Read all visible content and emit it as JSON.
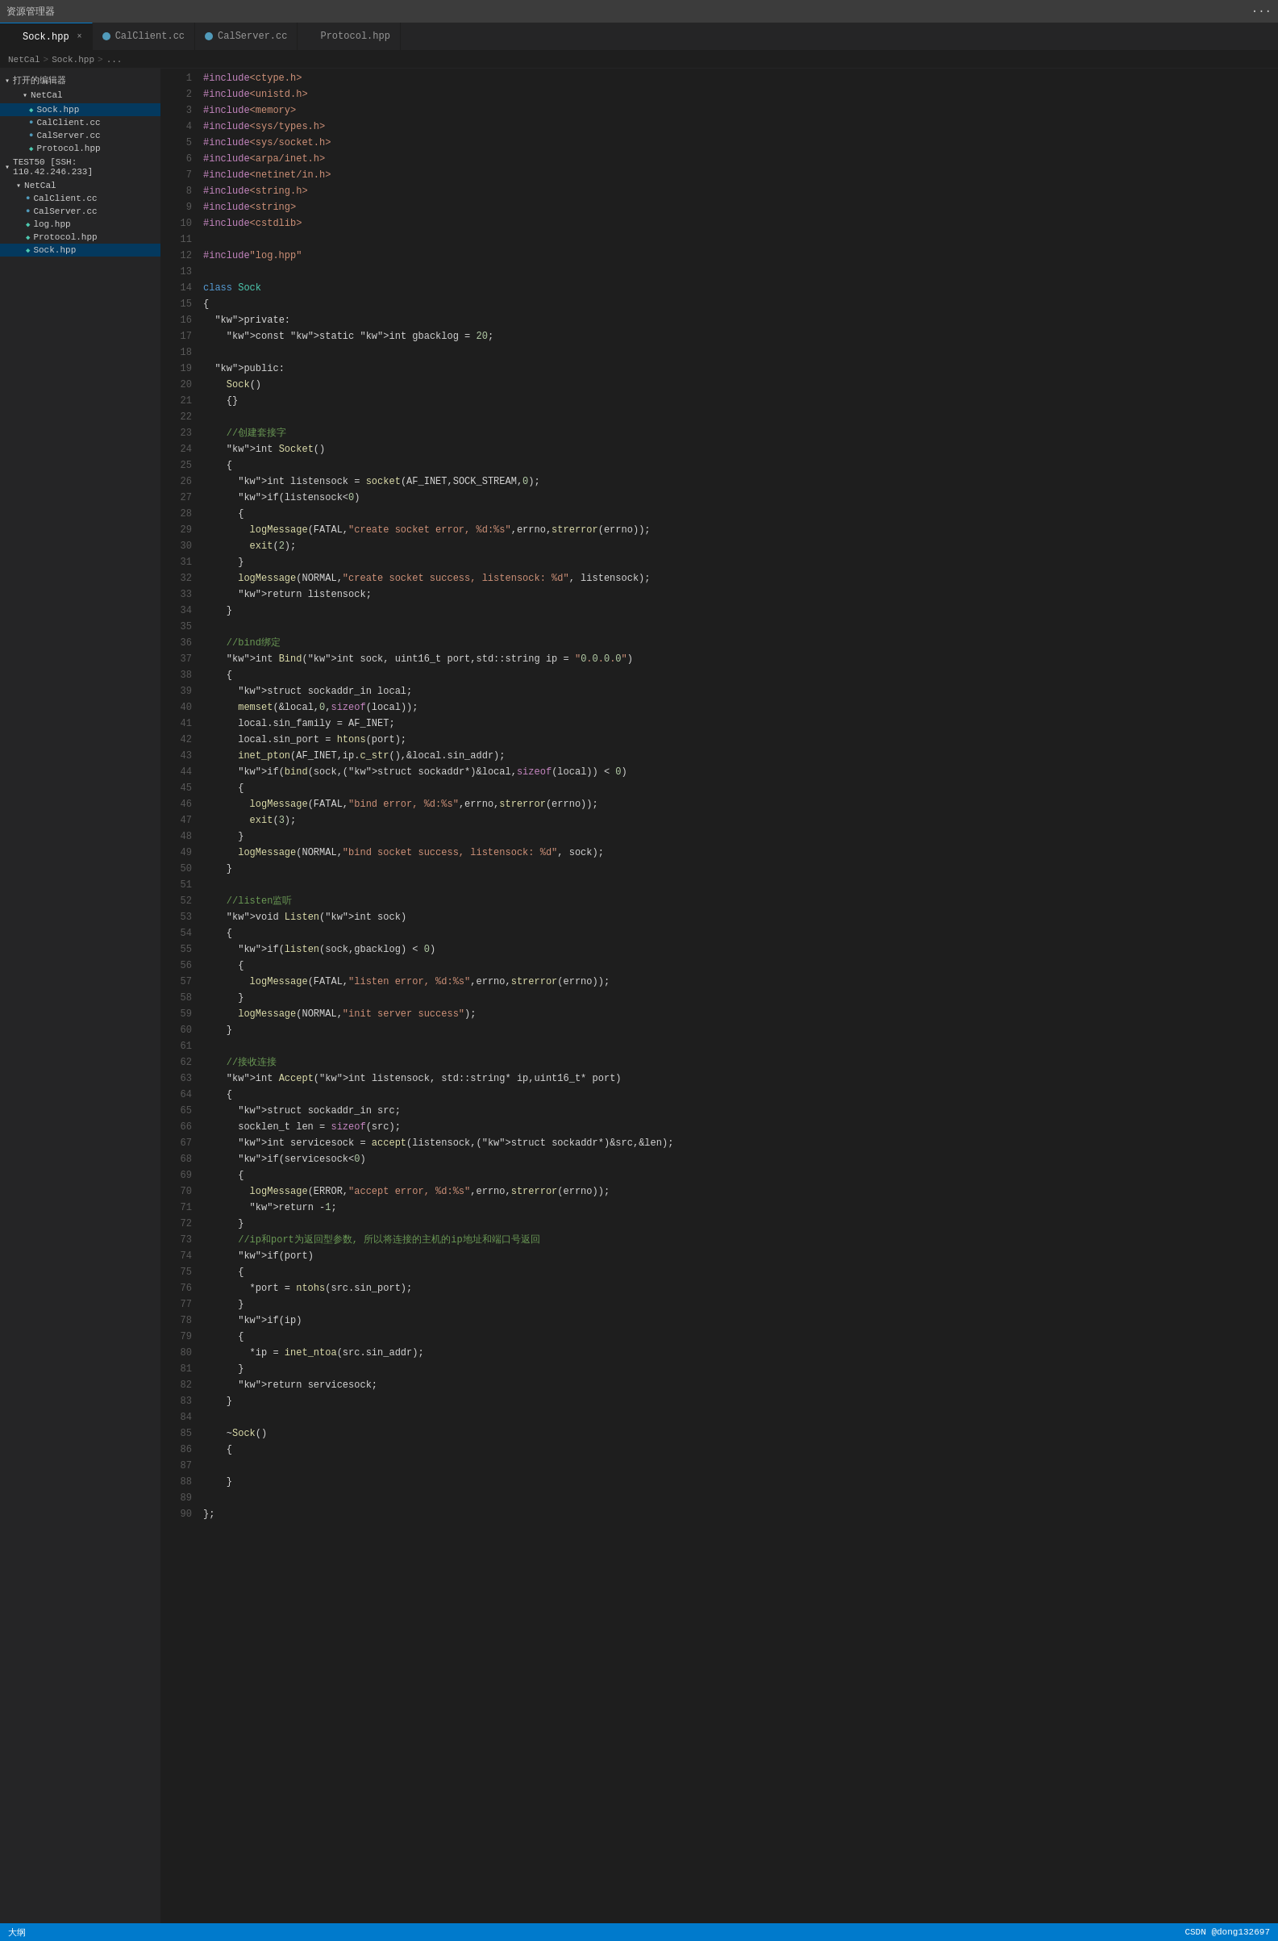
{
  "titleBar": {
    "text": "资源管理器",
    "menuDots": "···"
  },
  "tabs": [
    {
      "id": "sock-hpp",
      "label": "Sock.hpp",
      "iconType": "hpp",
      "active": true,
      "closeable": true
    },
    {
      "id": "calclient-cc",
      "label": "CalClient.cc",
      "iconType": "cc",
      "active": false,
      "closeable": false
    },
    {
      "id": "calserver-cc",
      "label": "CalServer.cc",
      "iconType": "cc",
      "active": false,
      "closeable": false
    },
    {
      "id": "protocol-hpp",
      "label": "Protocol.hpp",
      "iconType": "hpp",
      "active": false,
      "closeable": false
    }
  ],
  "breadcrumb": {
    "parts": [
      "NetCal",
      ">",
      "Sock.hpp",
      ">",
      "..."
    ]
  },
  "sidebar": {
    "openEditorLabel": "打开的编辑器",
    "netCalLabel": "NetCal",
    "openFiles": [
      {
        "name": "Sock.hpp",
        "type": "hpp",
        "project": "NetCal",
        "active": true
      },
      {
        "name": "CalClient.cc",
        "type": "cc",
        "project": "NetCal"
      },
      {
        "name": "CalServer.cc",
        "type": "cc",
        "project": "NetCal"
      },
      {
        "name": "Protocol.hpp",
        "type": "hpp",
        "project": "NetCal"
      }
    ],
    "testSSHLabel": "TEST50 [SSH: 110.42.246.233]",
    "testSSHFiles": [
      {
        "name": "CalClient.cc",
        "type": "cc"
      },
      {
        "name": "CalServer.cc",
        "type": "cc"
      },
      {
        "name": "log.hpp",
        "type": "hpp"
      },
      {
        "name": "Protocol.hpp",
        "type": "hpp"
      },
      {
        "name": "Sock.hpp",
        "type": "hpp",
        "active": true
      }
    ]
  },
  "codeLines": [
    {
      "n": 1,
      "text": "#include<ctype.h>"
    },
    {
      "n": 2,
      "text": "#include<unistd.h>"
    },
    {
      "n": 3,
      "text": "#include<memory>"
    },
    {
      "n": 4,
      "text": "#include<sys/types.h>"
    },
    {
      "n": 5,
      "text": "#include<sys/socket.h>"
    },
    {
      "n": 6,
      "text": "#include<arpa/inet.h>"
    },
    {
      "n": 7,
      "text": "#include<netinet/in.h>"
    },
    {
      "n": 8,
      "text": "#include<string.h>"
    },
    {
      "n": 9,
      "text": "#include<string>"
    },
    {
      "n": 10,
      "text": "#include<cstdlib>"
    },
    {
      "n": 11,
      "text": ""
    },
    {
      "n": 12,
      "text": "#include\"log.hpp\""
    },
    {
      "n": 13,
      "text": ""
    },
    {
      "n": 14,
      "text": "class Sock"
    },
    {
      "n": 15,
      "text": "{"
    },
    {
      "n": 16,
      "text": "  private:"
    },
    {
      "n": 17,
      "text": "    const static int gbacklog = 20;"
    },
    {
      "n": 18,
      "text": ""
    },
    {
      "n": 19,
      "text": "  public:"
    },
    {
      "n": 20,
      "text": "    Sock()"
    },
    {
      "n": 21,
      "text": "    {}"
    },
    {
      "n": 22,
      "text": ""
    },
    {
      "n": 23,
      "text": "    //创建套接字"
    },
    {
      "n": 24,
      "text": "    int Socket()"
    },
    {
      "n": 25,
      "text": "    {"
    },
    {
      "n": 26,
      "text": "      int listensock = socket(AF_INET,SOCK_STREAM,0);"
    },
    {
      "n": 27,
      "text": "      if(listensock<0)"
    },
    {
      "n": 28,
      "text": "      {"
    },
    {
      "n": 29,
      "text": "        logMessage(FATAL,\"create socket error, %d:%s\",errno,strerror(errno));"
    },
    {
      "n": 30,
      "text": "        exit(2);"
    },
    {
      "n": 31,
      "text": "      }"
    },
    {
      "n": 32,
      "text": "      logMessage(NORMAL,\"create socket success, listensock: %d\", listensock);"
    },
    {
      "n": 33,
      "text": "      return listensock;"
    },
    {
      "n": 34,
      "text": "    }"
    },
    {
      "n": 35,
      "text": ""
    },
    {
      "n": 36,
      "text": "    //bind绑定"
    },
    {
      "n": 37,
      "text": "    int Bind(int sock, uint16_t port,std::string ip = \"0.0.0.0\")"
    },
    {
      "n": 38,
      "text": "    {"
    },
    {
      "n": 39,
      "text": "      struct sockaddr_in local;"
    },
    {
      "n": 40,
      "text": "      memset(&local,0,sizeof(local));"
    },
    {
      "n": 41,
      "text": "      local.sin_family = AF_INET;"
    },
    {
      "n": 42,
      "text": "      local.sin_port = htons(port);"
    },
    {
      "n": 43,
      "text": "      inet_pton(AF_INET,ip.c_str(),&local.sin_addr);"
    },
    {
      "n": 44,
      "text": "      if(bind(sock,(struct sockaddr*)&local,sizeof(local)) < 0)"
    },
    {
      "n": 45,
      "text": "      {"
    },
    {
      "n": 46,
      "text": "        logMessage(FATAL,\"bind error, %d:%s\",errno,strerror(errno));"
    },
    {
      "n": 47,
      "text": "        exit(3);"
    },
    {
      "n": 48,
      "text": "      }"
    },
    {
      "n": 49,
      "text": "      logMessage(NORMAL,\"bind socket success, listensock: %d\", sock);"
    },
    {
      "n": 50,
      "text": "    }"
    },
    {
      "n": 51,
      "text": ""
    },
    {
      "n": 52,
      "text": "    //listen监听"
    },
    {
      "n": 53,
      "text": "    void Listen(int sock)"
    },
    {
      "n": 54,
      "text": "    {"
    },
    {
      "n": 55,
      "text": "      if(listen(sock,gbacklog) < 0)"
    },
    {
      "n": 56,
      "text": "      {"
    },
    {
      "n": 57,
      "text": "        logMessage(FATAL,\"listen error, %d:%s\",errno,strerror(errno));"
    },
    {
      "n": 58,
      "text": "      }"
    },
    {
      "n": 59,
      "text": "      logMessage(NORMAL,\"init server success\");"
    },
    {
      "n": 60,
      "text": "    }"
    },
    {
      "n": 61,
      "text": ""
    },
    {
      "n": 62,
      "text": "    //接收连接"
    },
    {
      "n": 63,
      "text": "    int Accept(int listensock, std::string* ip,uint16_t* port)"
    },
    {
      "n": 64,
      "text": "    {"
    },
    {
      "n": 65,
      "text": "      struct sockaddr_in src;"
    },
    {
      "n": 66,
      "text": "      socklen_t len = sizeof(src);"
    },
    {
      "n": 67,
      "text": "      int servicesock = accept(listensock,(struct sockaddr*)&src,&len);"
    },
    {
      "n": 68,
      "text": "      if(servicesock<0)"
    },
    {
      "n": 69,
      "text": "      {"
    },
    {
      "n": 70,
      "text": "        logMessage(ERROR,\"accept error, %d:%s\",errno,strerror(errno));"
    },
    {
      "n": 71,
      "text": "        return -1;"
    },
    {
      "n": 72,
      "text": "      }"
    },
    {
      "n": 73,
      "text": "      //ip和port为返回型参数, 所以将连接的主机的ip地址和端口号返回"
    },
    {
      "n": 74,
      "text": "      if(port)"
    },
    {
      "n": 75,
      "text": "      {"
    },
    {
      "n": 76,
      "text": "        *port = ntohs(src.sin_port);"
    },
    {
      "n": 77,
      "text": "      }"
    },
    {
      "n": 78,
      "text": "      if(ip)"
    },
    {
      "n": 79,
      "text": "      {"
    },
    {
      "n": 80,
      "text": "        *ip = inet_ntoa(src.sin_addr);"
    },
    {
      "n": 81,
      "text": "      }"
    },
    {
      "n": 82,
      "text": "      return servicesock;"
    },
    {
      "n": 83,
      "text": "    }"
    },
    {
      "n": 84,
      "text": ""
    },
    {
      "n": 85,
      "text": "    ~Sock()"
    },
    {
      "n": 86,
      "text": "    {"
    },
    {
      "n": 87,
      "text": ""
    },
    {
      "n": 88,
      "text": "    }"
    },
    {
      "n": 89,
      "text": ""
    },
    {
      "n": 90,
      "text": "};"
    }
  ],
  "statusBar": {
    "leftItems": [
      "大纲"
    ],
    "rightItems": [
      "CSDN @dong132697"
    ]
  }
}
